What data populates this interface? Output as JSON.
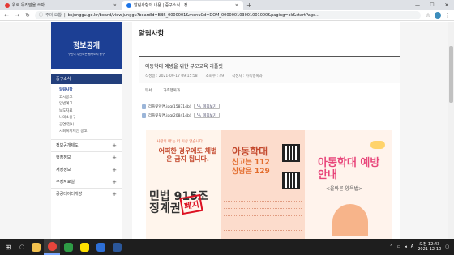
{
  "browser": {
    "tabs": [
      {
        "label": "위로 우리말을 쓰자"
      },
      {
        "label": "알림사항의 내용 | 중구소식 | 정"
      }
    ],
    "new_tab": "+",
    "window_controls": [
      "—",
      "☐",
      "✕"
    ],
    "address": {
      "not_secure": "주의 요함",
      "url": "bsjunggu.go.kr/board/view.junggu?boardId=BBS_0000001&menuCd=DOM_000000103001001000&paging=ok&startPage..."
    }
  },
  "sidebar": {
    "title": "정보공개",
    "subtitle": "구민이 주인되는 행복도시 중구",
    "section_label": "중구소식",
    "section_icon": "−",
    "subitems": [
      "알림사항",
      "고시공고",
      "입법예고",
      "보도자료",
      "나의소중구",
      "공연/전시",
      "시회복지제안 공고"
    ],
    "items": [
      "정보공개제도",
      "행정정보",
      "재정정보",
      "구정자료실",
      "공공데이터개방"
    ],
    "plus": "+"
  },
  "content": {
    "page_title": "알림사항",
    "post": {
      "title": "아동학대 예방을 위한 부모교육 리플릿",
      "meta": [
        "작성일 : 2021-09-17 09:15:58",
        "조회수 : 49",
        "작성자 : 가족행복과"
      ],
      "dept_label": "부서",
      "dept_value": "가족행복과"
    },
    "attachments": [
      {
        "name": "리플릿앞면.jpg(158714b)",
        "button": "미리보기"
      },
      {
        "name": "리플릿뒷면.jpg(208414b)",
        "button": "미리보기"
      }
    ]
  },
  "poster": {
    "left_top": "'사랑의 매'는 더 이상 없습니다.",
    "left_big": "어떠한 경우에도 체벌은 금지 됩니다.",
    "left_law": "민법 915조 징계권",
    "stamp": "폐지",
    "mid_title": "아동학대",
    "mid_line1": "신고는 112",
    "mid_line2": "상담은 129",
    "right_title": "아동학대 예방 안내",
    "right_sub": "<올바른 양육법>"
  },
  "taskbar": {
    "apps": [
      {
        "name": "file-explorer",
        "color": "#f2c14e"
      },
      {
        "name": "chrome",
        "color": "#e8453c"
      },
      {
        "name": "app-green",
        "color": "#2e9b45"
      },
      {
        "name": "kakaotalk",
        "color": "#ffe000"
      },
      {
        "name": "app-blue",
        "color": "#2d6fd6"
      },
      {
        "name": "word",
        "color": "#2b579a"
      }
    ],
    "tray_lang": "A",
    "time": "오전 12:43",
    "date": "2021-12-10"
  }
}
